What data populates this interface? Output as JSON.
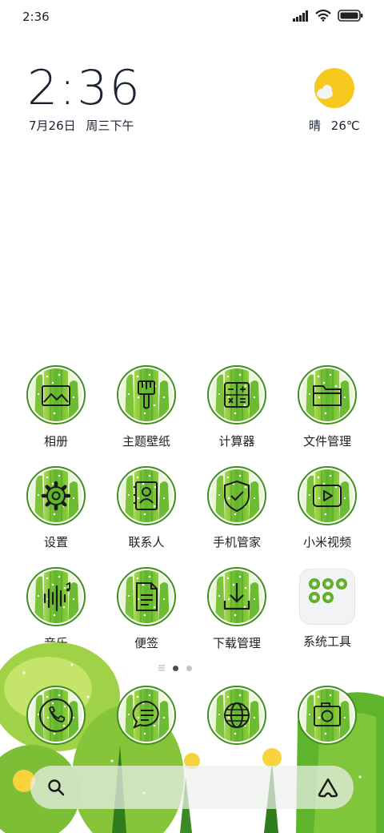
{
  "status_bar": {
    "time": "2:36",
    "battery": "full"
  },
  "clock": {
    "time": "2:36",
    "date": "7月26日",
    "weekday": "周三",
    "period": "下午"
  },
  "weather": {
    "condition": "晴",
    "temperature": "26℃",
    "icon": "sun-cloud-icon"
  },
  "apps": [
    {
      "label": "相册",
      "icon": "gallery-icon"
    },
    {
      "label": "主题壁纸",
      "icon": "brush-icon"
    },
    {
      "label": "计算器",
      "icon": "calculator-icon"
    },
    {
      "label": "文件管理",
      "icon": "folder-icon"
    },
    {
      "label": "设置",
      "icon": "gear-icon"
    },
    {
      "label": "联系人",
      "icon": "contacts-icon"
    },
    {
      "label": "手机管家",
      "icon": "shield-icon"
    },
    {
      "label": "小米视频",
      "icon": "play-icon"
    },
    {
      "label": "音乐",
      "icon": "music-wave-icon"
    },
    {
      "label": "便签",
      "icon": "notes-icon"
    },
    {
      "label": "下载管理",
      "icon": "download-icon"
    },
    {
      "label": "系统工具",
      "icon": "folder-group-icon"
    }
  ],
  "dock": [
    {
      "icon": "phone-icon"
    },
    {
      "icon": "message-icon"
    },
    {
      "icon": "browser-icon"
    },
    {
      "icon": "camera-icon"
    }
  ],
  "page_indicator": {
    "total": 2,
    "current": 1
  },
  "colors": {
    "accent_green": "#5aa82a",
    "sun_yellow": "#f7c81e",
    "text_dark": "#1c2433"
  }
}
